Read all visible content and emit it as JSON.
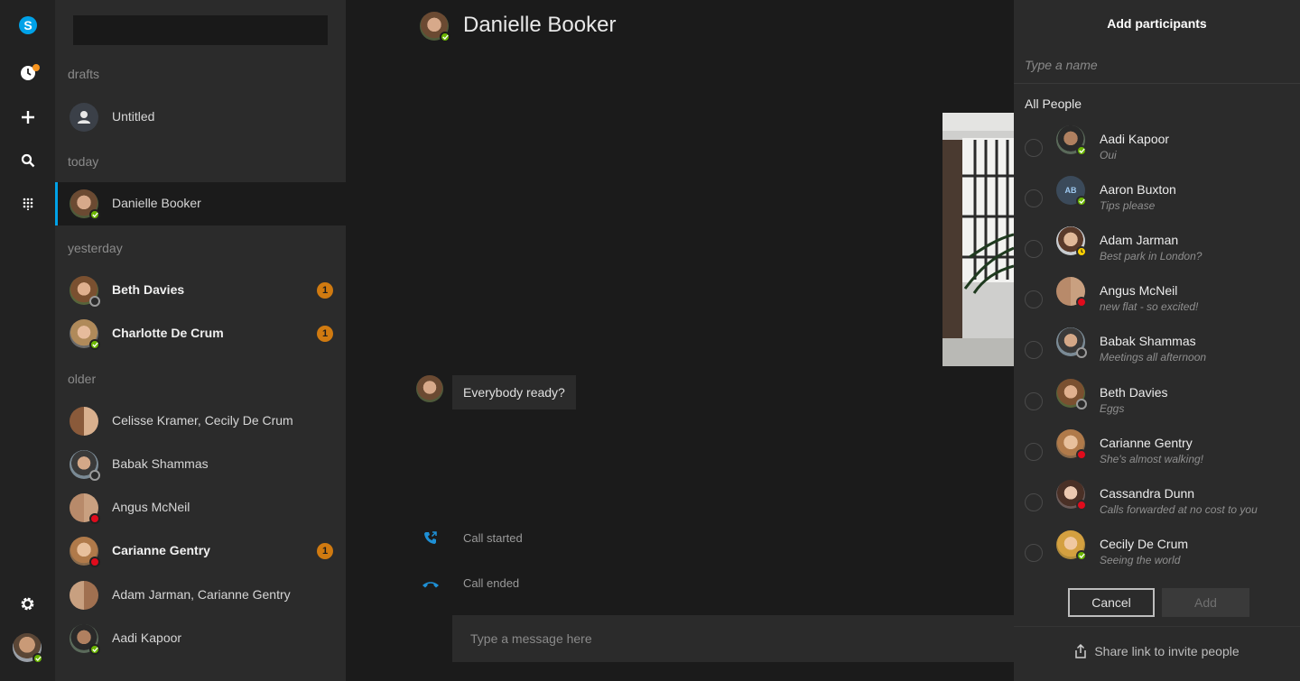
{
  "rail": {
    "items": [
      "skype-logo-icon",
      "recent-icon",
      "add-icon",
      "search-icon",
      "dialpad-icon",
      "settings-icon"
    ],
    "accent": "#00a2e8",
    "notification_color": "#f7941e"
  },
  "conversations": {
    "search_placeholder": "",
    "sections": {
      "drafts": "drafts",
      "today": "today",
      "yesterday": "yesterday",
      "older": "older"
    },
    "items": [
      {
        "name": "Untitled",
        "unread": null
      },
      {
        "name": "Danielle Booker",
        "unread": null
      },
      {
        "name": "Beth Davies",
        "unread": "1"
      },
      {
        "name": "Charlotte De Crum",
        "unread": "1"
      },
      {
        "name": "Celisse Kramer, Cecily De Crum",
        "unread": null
      },
      {
        "name": "Babak Shammas",
        "unread": null
      },
      {
        "name": "Angus McNeil",
        "unread": null
      },
      {
        "name": "Carianne Gentry",
        "unread": "1"
      },
      {
        "name": "Adam Jarman, Carianne Gentry",
        "unread": null
      },
      {
        "name": "Aadi Kapoor",
        "unread": null
      }
    ]
  },
  "chat": {
    "title": "Danielle Booker",
    "message": "Everybody ready?",
    "call_started": "Call started",
    "call_ended": "Call ended",
    "composer_placeholder": "Type a message here"
  },
  "panel": {
    "title": "Add participants",
    "input_placeholder": "Type a name",
    "section": "All People",
    "people": [
      {
        "name": "Aadi Kapoor",
        "mood": "Oui",
        "status": "online"
      },
      {
        "name": "Aaron Buxton",
        "mood": "Tips please",
        "status": "online",
        "initials": "AB"
      },
      {
        "name": "Adam Jarman",
        "mood": "Best park in London?",
        "status": "away"
      },
      {
        "name": "Angus McNeil",
        "mood": "new flat - so excited!",
        "status": "busy"
      },
      {
        "name": "Babak Shammas",
        "mood": "Meetings all afternoon",
        "status": "offline"
      },
      {
        "name": "Beth Davies",
        "mood": "Eggs",
        "status": "offline"
      },
      {
        "name": "Carianne Gentry",
        "mood": "She's almost walking!",
        "status": "busy"
      },
      {
        "name": "Cassandra Dunn",
        "mood": "Calls forwarded at no cost to you",
        "status": "busy"
      },
      {
        "name": "Cecily De Crum",
        "mood": "Seeing the world",
        "status": "online"
      }
    ],
    "cancel_label": "Cancel",
    "add_label": "Add",
    "share_label": "Share link to invite people"
  },
  "colors": {
    "online": "#6bb700",
    "busy": "#e00b1c",
    "away": "#ffd200",
    "unread_badge": "#d07a10",
    "call_icon": "#1e90d6"
  }
}
